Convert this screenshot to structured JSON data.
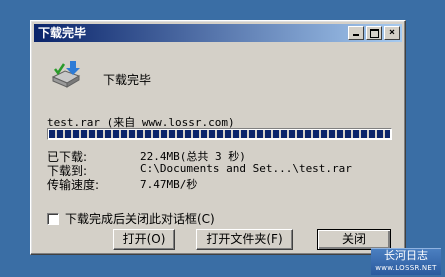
{
  "window": {
    "title": "下载完毕"
  },
  "title_buttons": {
    "close": "×"
  },
  "status": {
    "heading": "下载完毕",
    "filename_line": "test.rar (来自 www.lossr.com)",
    "progress_fraction": 1.0
  },
  "details": [
    {
      "label": "已下载:",
      "value": "22.4MB(总共 3 秒)"
    },
    {
      "label": "下载到:",
      "value": "C:\\Documents and Set...\\test.rar"
    },
    {
      "label": "传输速度:",
      "value": "7.47MB/秒"
    }
  ],
  "checkbox": {
    "label": "下载完成后关闭此对话框(C)",
    "checked": false
  },
  "buttons": {
    "open": "打开(O)",
    "open_folder": "打开文件夹(F)",
    "close": "关闭"
  },
  "watermark": {
    "title": "长河日志",
    "url": "www.LOSSR.NET"
  }
}
